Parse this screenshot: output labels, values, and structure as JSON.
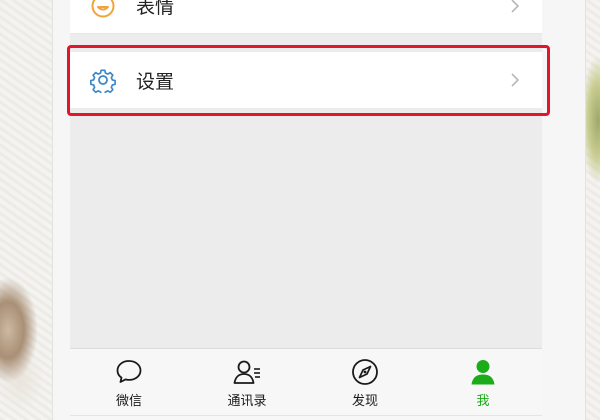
{
  "menu": {
    "emoji_label": "表情",
    "settings_label": "设置"
  },
  "tabbar": {
    "tabs": [
      {
        "label": "微信",
        "icon": "chat-bubble-icon",
        "active": false
      },
      {
        "label": "通讯录",
        "icon": "contacts-icon",
        "active": false
      },
      {
        "label": "发现",
        "icon": "compass-icon",
        "active": false
      },
      {
        "label": "我",
        "icon": "person-icon",
        "active": true
      }
    ]
  },
  "colors": {
    "accent_green": "#1aad19",
    "highlight_red": "#e0162c",
    "settings_icon_blue": "#3b87c8",
    "emoji_icon_orange": "#f0a43a"
  }
}
